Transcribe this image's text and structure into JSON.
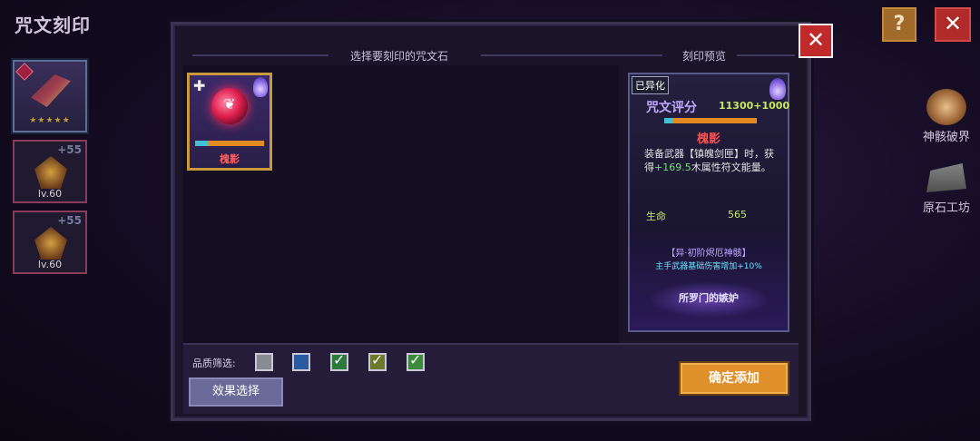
{
  "screen_title": "咒文刻印",
  "top_buttons": {
    "help_label": "?",
    "close_label": "✕"
  },
  "weapons": [
    {
      "stars": "★★★★★",
      "selected": true
    },
    {
      "plus": "+55",
      "level": "lv.60"
    },
    {
      "plus": "+55",
      "level": "lv.60"
    }
  ],
  "side_features": [
    {
      "label": "神骸破界",
      "icon": "bone-relic-icon"
    },
    {
      "label": "原石工坊",
      "icon": "forge-icon"
    }
  ],
  "panel": {
    "left_header": "选择要刻印的咒文石",
    "right_header": "刻印预览",
    "close_label": "✕"
  },
  "rune_card": {
    "name": "槐影",
    "icon": "rune-gem-icon"
  },
  "preview": {
    "tag": "已异化",
    "score_label": "咒文评分",
    "score_value": "11300+1000",
    "rune_name": "槐影",
    "desc_prefix": "装备武器【镇魄剑匣】时，获得",
    "desc_highlight": "+169.5",
    "desc_suffix": "木属性符文能量。",
    "stat_name": "生命",
    "stat_value": "565",
    "set_name": "【异·初阶烬厄神骸】",
    "set_effect": "主手武器基础伤害增加+10%",
    "suit_name": "所罗门的嫉妒"
  },
  "filter": {
    "label": "品质筛选:",
    "options": [
      {
        "color": "#8a8a92",
        "checked": false
      },
      {
        "color": "#2a5aa0",
        "checked": false
      },
      {
        "color": "#2a7a3a",
        "checked": true
      },
      {
        "color": "#6a7a2a",
        "checked": true
      },
      {
        "color": "#3a8a3a",
        "checked": true
      }
    ],
    "check_glyph": "✓"
  },
  "buttons": {
    "effect_select": "效果选择",
    "confirm_add": "确定添加"
  }
}
